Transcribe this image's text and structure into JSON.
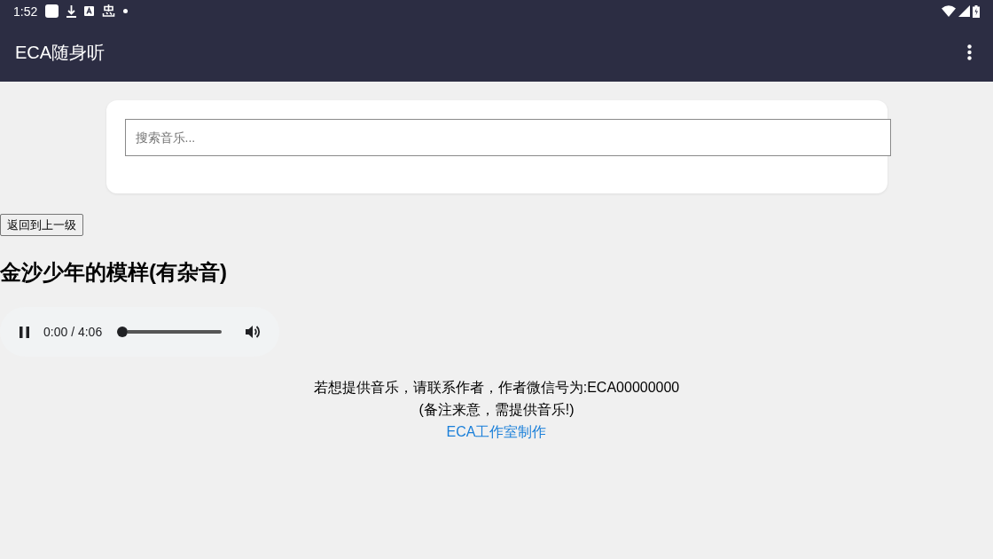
{
  "status_bar": {
    "time": "1:52"
  },
  "app_bar": {
    "title": "ECA随身听"
  },
  "search": {
    "placeholder": "搜索音乐..."
  },
  "back_button": {
    "label": "返回到上一级"
  },
  "track": {
    "title": "金沙少年的模样(有杂音)"
  },
  "player": {
    "playing": true,
    "time": "0:00 / 4:06",
    "level": 0
  },
  "footer": {
    "lines": [
      "若想提供音乐，请联系作者，作者微信号为:ECA00000000",
      "(备注来意，需提供音乐!)"
    ],
    "link": "ECA工作室制作"
  }
}
